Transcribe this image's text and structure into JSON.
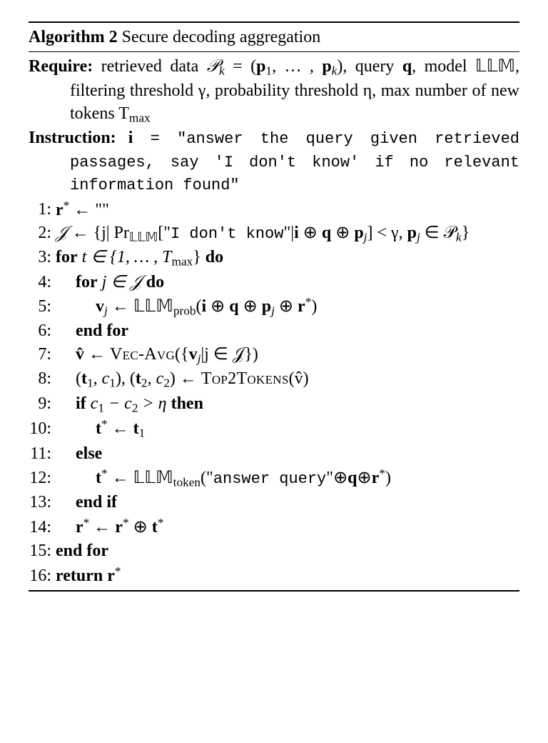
{
  "title_label": "Algorithm 2",
  "title_text": "Secure decoding aggregation",
  "require_label": "Require:",
  "require_text_1": "retrieved data ",
  "require_sym_Pk": "𝒫",
  "require_text_2": " = (",
  "require_text_3": ", … , ",
  "require_text_4": "), query ",
  "require_text_5": ", model ",
  "require_text_6": ", filtering threshold γ, probability threshold η, max number of new tokens T",
  "instruction_label": "Instruction:",
  "instruction_text_1": " = ",
  "instruction_quote": "\"answer the query given retrieved passages, say 'I don't know' if no relevant information found\"",
  "lines": {
    "l1_a": "r",
    "l1_b": " ← \"\"",
    "l2_a": "𝒥",
    "l2_b": "  ←  {j| Pr",
    "l2_c": "[\"",
    "l2_idk": "I don't know",
    "l2_d": "\"|",
    "l2_e": " ⊕ ",
    "l2_f": "] < γ, ",
    "l2_g": " ∈ 𝒫",
    "l2_h": "}",
    "l3_a": "for",
    "l3_b": " t ∈ {1, … , T",
    "l3_c": "} ",
    "l3_d": "do",
    "l4_a": "for",
    "l4_b": " j ∈ 𝒥 ",
    "l4_c": "do",
    "l5_a": "v",
    "l5_b": " ← ",
    "l5_c": "(",
    "l5_d": " ⊕ ",
    "l5_e": ")",
    "l6": "end for",
    "l7_a": "v̂ ← ",
    "l7_b": "Vec-Avg",
    "l7_c": "({",
    "l7_d": "|j ∈ 𝒥})",
    "l8_a": "(",
    "l8_b": ", c",
    "l8_c": "), (",
    "l8_d": ") ← ",
    "l8_e": "Top2Tokens",
    "l8_f": "(v̂)",
    "l9_a": "if",
    "l9_b": " c",
    "l9_c": " − c",
    "l9_d": " > η ",
    "l9_e": "then",
    "l10_a": "t",
    "l10_b": " ← ",
    "l11": "else",
    "l12_a": "t",
    "l12_b": " ← ",
    "l12_c": "(\"",
    "l12_q": "answer query",
    "l12_d": "\"⊕",
    "l12_e": "⊕",
    "l12_f": ")",
    "l13": "end if",
    "l14_a": "r",
    "l14_b": " ← ",
    "l14_c": " ⊕ ",
    "l15": "end for",
    "l16_a": "return",
    "l16_b": "  r"
  },
  "math": {
    "p": "p",
    "q": "q",
    "i": "i",
    "r": "r",
    "t": "t",
    "v": "v",
    "k": "k",
    "j": "j",
    "1": "1",
    "2": "2",
    "star": "*",
    "max": "max",
    "prob": "prob",
    "token": "token",
    "LLM": "𝕃𝕃𝕄"
  }
}
